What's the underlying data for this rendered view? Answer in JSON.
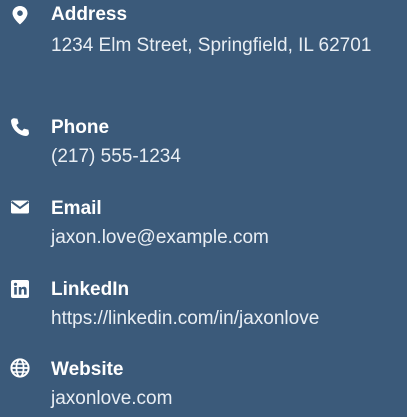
{
  "colors": {
    "background": "#3b5a7a",
    "text": "#ffffff"
  },
  "contacts": [
    {
      "icon": "map-marker-icon",
      "label": "Address",
      "value": "1234 Elm Street, Springfield, IL 62701"
    },
    {
      "icon": "phone-icon",
      "label": "Phone",
      "value": "(217) 555-1234"
    },
    {
      "icon": "envelope-icon",
      "label": "Email",
      "value": "jaxon.love@example.com"
    },
    {
      "icon": "linkedin-icon",
      "label": "LinkedIn",
      "value": "https://linkedin.com/in/jaxonlove"
    },
    {
      "icon": "globe-icon",
      "label": "Website",
      "value": "jaxonlove.com"
    }
  ]
}
